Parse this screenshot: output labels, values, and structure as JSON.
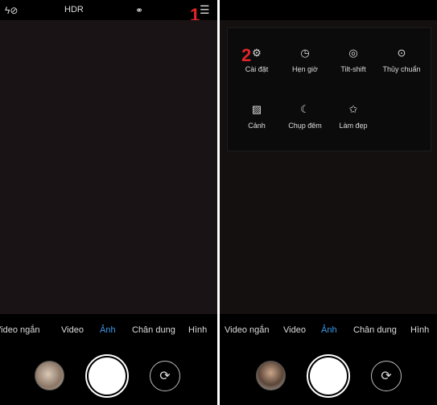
{
  "left": {
    "topbar": {
      "flash_icon": "flash-off-icon",
      "hdr_label": "HDR",
      "filter_icon": "filters-icon",
      "menu_icon": "hamburger-menu-icon"
    },
    "marker": "1",
    "modes": [
      "Video ngắn",
      "Video",
      "Ảnh",
      "Chân dung",
      "Hình"
    ],
    "active_mode": "Ảnh"
  },
  "right": {
    "marker": "2",
    "menu": [
      {
        "label": "Cài đặt",
        "icon": "gear-icon"
      },
      {
        "label": "Hẹn giờ",
        "icon": "clock-icon"
      },
      {
        "label": "Tilt-shift",
        "icon": "tilt-shift-icon"
      },
      {
        "label": "Thủy chuẩn",
        "icon": "level-icon"
      },
      {
        "label": "Cảnh",
        "icon": "landscape-icon"
      },
      {
        "label": "Chụp đêm",
        "icon": "moon-icon"
      },
      {
        "label": "Làm đẹp",
        "icon": "beauty-wand-icon"
      }
    ],
    "modes": [
      "Video ngắn",
      "Video",
      "Ảnh",
      "Chân dung",
      "Hình"
    ],
    "active_mode": "Ảnh"
  },
  "colors": {
    "accent": "#3d9be9",
    "marker": "#e0262a",
    "viewfinder": "#1a1315"
  }
}
